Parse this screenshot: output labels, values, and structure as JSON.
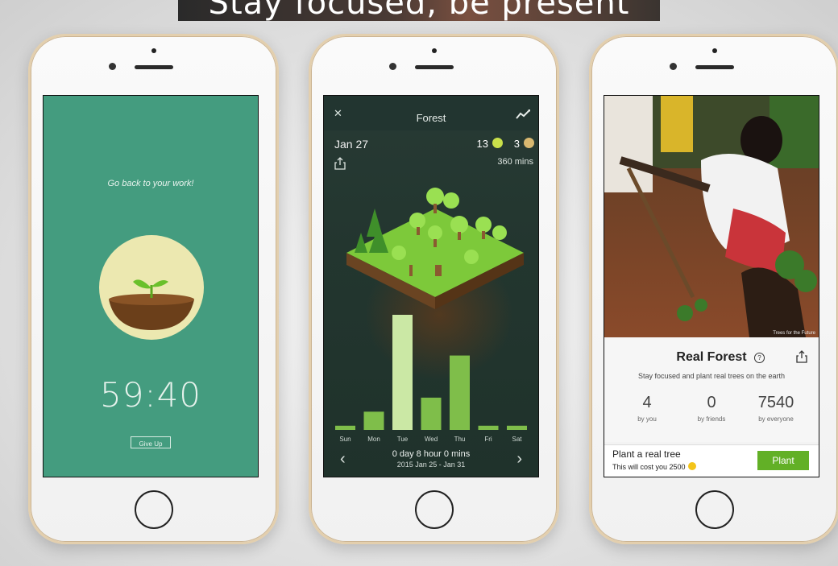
{
  "banner": {
    "text": "Stay focused, be present"
  },
  "phone1": {
    "message": "Go back to your work!",
    "timer": "59:40",
    "give_up_label": "Give Up"
  },
  "phone2": {
    "title": "Forest",
    "date": "Jan 27",
    "trees_count": "13",
    "dead_count": "3",
    "minutes": "360 mins",
    "summary": "0 day 8 hour 0 mins",
    "range": "2015 Jan 25 - Jan 31",
    "chart_data": {
      "type": "bar",
      "categories": [
        "Sun",
        "Mon",
        "Tue",
        "Wed",
        "Thu",
        "Fri",
        "Sat"
      ],
      "values": [
        0.3,
        1.3,
        8.2,
        2.3,
        5.3,
        0.3,
        0.3
      ],
      "title": "",
      "xlabel": "",
      "ylabel": ""
    },
    "colors": {
      "bar_light": "#cbe8a5",
      "bar_mid": "#7fbe4a",
      "background": "#23362f"
    }
  },
  "phone3": {
    "title": "Real Forest",
    "subtitle": "Stay focused and plant real trees on the earth",
    "stats": [
      {
        "value": "4",
        "label": "by you"
      },
      {
        "value": "0",
        "label": "by friends"
      },
      {
        "value": "7540",
        "label": "by everyone"
      }
    ],
    "plant_title": "Plant a real tree",
    "plant_cost": "This will cost you 2500",
    "plant_button": "Plant",
    "photo_credit": "Trees for the Future"
  },
  "colors": {
    "timer_bg": "#449c7f",
    "plant_button": "#62b026"
  }
}
